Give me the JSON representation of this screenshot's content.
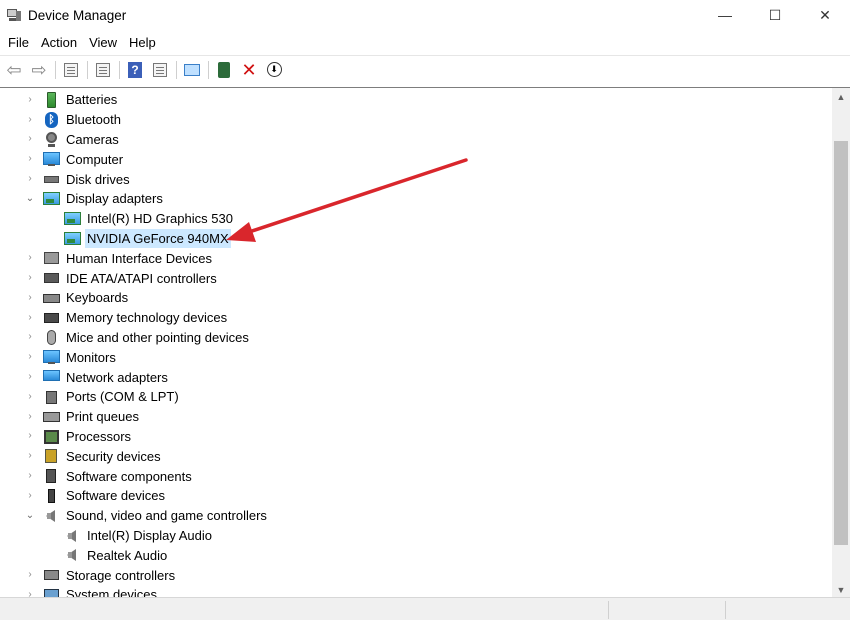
{
  "window": {
    "title": "Device Manager",
    "minimize": "—",
    "maximize": "☐",
    "close": "✕"
  },
  "menu": [
    "File",
    "Action",
    "View",
    "Help"
  ],
  "toolbar": {
    "back": "⇦",
    "forward": "⇨",
    "help": "?",
    "uninstall": "✕",
    "update": "⬇"
  },
  "tree": [
    {
      "label": "Batteries",
      "icon": "battery-icon",
      "level": 0,
      "expanded": false
    },
    {
      "label": "Bluetooth",
      "icon": "bluetooth-icon",
      "level": 0,
      "expanded": false
    },
    {
      "label": "Cameras",
      "icon": "camera-icon",
      "level": 0,
      "expanded": false
    },
    {
      "label": "Computer",
      "icon": "monitor-icon",
      "level": 0,
      "expanded": false
    },
    {
      "label": "Disk drives",
      "icon": "disk-drive-icon",
      "level": 0,
      "expanded": false
    },
    {
      "label": "Display adapters",
      "icon": "display-adapter-icon",
      "level": 0,
      "expanded": true
    },
    {
      "label": "Intel(R) HD Graphics 530",
      "icon": "display-adapter-icon",
      "level": 1
    },
    {
      "label": "NVIDIA GeForce 940MX",
      "icon": "display-adapter-icon",
      "level": 1,
      "selected": true
    },
    {
      "label": "Human Interface Devices",
      "icon": "hid-icon",
      "level": 0,
      "expanded": false
    },
    {
      "label": "IDE ATA/ATAPI controllers",
      "icon": "ide-controller-icon",
      "level": 0,
      "expanded": false
    },
    {
      "label": "Keyboards",
      "icon": "keyboard-icon",
      "level": 0,
      "expanded": false
    },
    {
      "label": "Memory technology devices",
      "icon": "memory-icon",
      "level": 0,
      "expanded": false
    },
    {
      "label": "Mice and other pointing devices",
      "icon": "mouse-icon",
      "level": 0,
      "expanded": false
    },
    {
      "label": "Monitors",
      "icon": "monitor-icon",
      "level": 0,
      "expanded": false
    },
    {
      "label": "Network adapters",
      "icon": "network-adapter-icon",
      "level": 0,
      "expanded": false
    },
    {
      "label": "Ports (COM & LPT)",
      "icon": "port-icon",
      "level": 0,
      "expanded": false
    },
    {
      "label": "Print queues",
      "icon": "printer-icon",
      "level": 0,
      "expanded": false
    },
    {
      "label": "Processors",
      "icon": "processor-icon",
      "level": 0,
      "expanded": false
    },
    {
      "label": "Security devices",
      "icon": "security-device-icon",
      "level": 0,
      "expanded": false
    },
    {
      "label": "Software components",
      "icon": "software-component-icon",
      "level": 0,
      "expanded": false
    },
    {
      "label": "Software devices",
      "icon": "software-device-icon",
      "level": 0,
      "expanded": false
    },
    {
      "label": "Sound, video and game controllers",
      "icon": "speaker-icon",
      "level": 0,
      "expanded": true
    },
    {
      "label": "Intel(R) Display Audio",
      "icon": "speaker-icon",
      "level": 1
    },
    {
      "label": "Realtek Audio",
      "icon": "speaker-icon",
      "level": 1
    },
    {
      "label": "Storage controllers",
      "icon": "storage-controller-icon",
      "level": 0,
      "expanded": false
    },
    {
      "label": "System devices",
      "icon": "system-device-icon",
      "level": 0,
      "expanded": false
    }
  ],
  "annotation": {
    "color": "#d9262c"
  }
}
